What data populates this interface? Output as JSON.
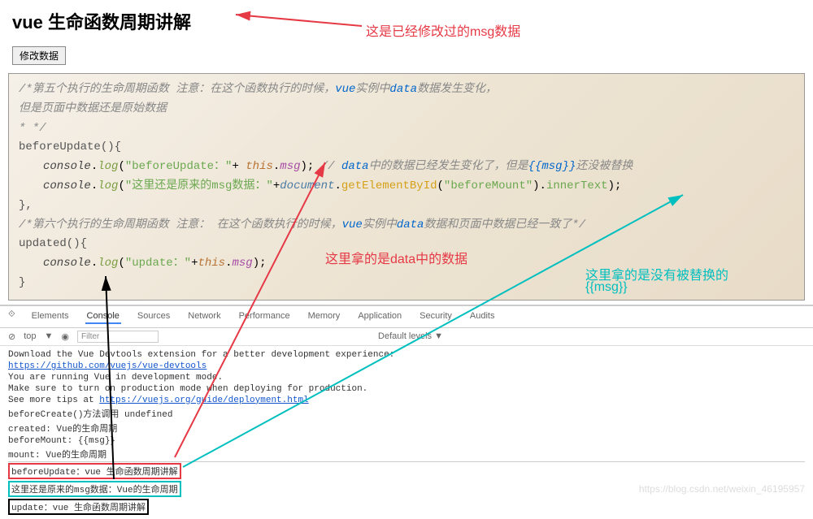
{
  "header": {
    "title": "vue 生命函数周期讲解"
  },
  "button": {
    "modify": "修改数据"
  },
  "annotations": {
    "a1": "这是已经修改过的msg数据",
    "a2": "这里拿的是data中的数据",
    "a3": "这里拿的是没有被替换的",
    "a4": "{{msg}}"
  },
  "code": {
    "c1a": "/*第五个执行的生命周期函数   注意：在这个函数执行的时候，",
    "c1b": "vue",
    "c1c": "实例中",
    "c1d": "data",
    "c1e": "数据发生变化，",
    "c2": "但是页面中数据还是原始数据",
    "c3": "* */",
    "c4": "beforeUpdate(){",
    "c5a": "console",
    "c5b": ".",
    "c5c": "log",
    "c5d": "(",
    "c5e": "\"beforeUpdate：\"",
    "c5f": "+ ",
    "c5g": "this",
    "c5h": ".",
    "c5i": "msg",
    "c5j": ");   ",
    "c5k": "// ",
    "c5l": "data",
    "c5m": "中的数据已经发生变化了，但是",
    "c5n": "{{msg}}",
    "c5o": "还没被替换",
    "c6e": "\"这里还是原来的msg数据：\"",
    "c6f": "+",
    "c6g": "document",
    "c6h": ".",
    "c6i": "getElementById",
    "c6j": "(",
    "c6k": "\"beforeMount\"",
    "c6l": ").",
    "c6m": "innerText",
    "c6n": ");",
    "c7": "},",
    "c8a": "/*第六个执行的生命周期函数    注意： 在这个函数执行的时候，",
    "c8b": "vue",
    "c8c": "实例中",
    "c8d": "data",
    "c8e": "数据和页面中数据已经一致了*/",
    "c9": "updated(){",
    "c10e": "\"update：\"",
    "c10f": "+",
    "c10g": "this",
    "c10h": ".",
    "c10i": "msg",
    "c10j": ");",
    "c11": "}"
  },
  "devtools": {
    "tabs": [
      "Elements",
      "Console",
      "Sources",
      "Network",
      "Performance",
      "Memory",
      "Application",
      "Security",
      "Audits"
    ],
    "toolbar": {
      "top": "top",
      "filter": "Filter",
      "levels": "Default levels ▼"
    },
    "lines": {
      "l1": "Download the Vue Devtools extension for a better development experience:",
      "l1link": "https://github.com/vuejs/vue-devtools",
      "l2": "You are running Vue in development mode.",
      "l3": "Make sure to turn on production mode when deploying for production.",
      "l4a": "See more tips at ",
      "l4link": "https://vuejs.org/guide/deployment.html",
      "l5": "beforeCreate()方法调用 undefined",
      "l6": "created: Vue的生命周期",
      "l7": "beforeMount: {{msg}}",
      "l8": "mount: Vue的生命周期",
      "l9": "beforeUpdate：vue 生命函数周期讲解",
      "l10": "这里还是原来的msg数据：Vue的生命周期",
      "l11": "update：vue 生命函数周期讲解"
    }
  },
  "watermark": "https://blog.csdn.net/weixin_46195957"
}
